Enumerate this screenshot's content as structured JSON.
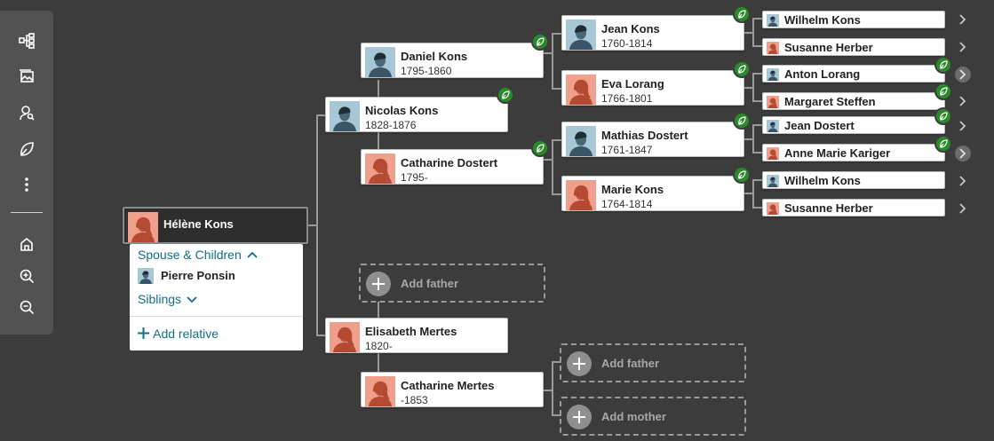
{
  "toolbar": {
    "items": [
      {
        "name": "tree-view-icon"
      },
      {
        "name": "media-icon"
      },
      {
        "name": "person-search-icon"
      },
      {
        "name": "hints-leaf-icon"
      },
      {
        "name": "more-options-icon"
      },
      {
        "name": "home-icon"
      },
      {
        "name": "zoom-in-icon"
      },
      {
        "name": "zoom-out-icon"
      }
    ]
  },
  "focus": {
    "name": "Hélène Kons",
    "gender": "female"
  },
  "panel": {
    "spouse_children_label": "Spouse & Children",
    "spouse_name": "Pierre Ponsin",
    "siblings_label": "Siblings",
    "add_relative_label": "Add relative"
  },
  "people": {
    "nicolas": {
      "name": "Nicolas Kons",
      "dates": "1828-1876",
      "gender": "male"
    },
    "elisabeth": {
      "name": "Elisabeth Mertes",
      "dates": "1820-",
      "gender": "female"
    },
    "daniel": {
      "name": "Daniel Kons",
      "dates": "1795-1860",
      "gender": "male"
    },
    "catharine_d": {
      "name": "Catharine Dostert",
      "dates": "1795-",
      "gender": "female"
    },
    "catharine_m": {
      "name": "Catharine Mertes",
      "dates": "-1853",
      "gender": "female"
    },
    "jean": {
      "name": "Jean Kons",
      "dates": "1760-1814",
      "gender": "male"
    },
    "eva": {
      "name": "Eva Lorang",
      "dates": "1766-1801",
      "gender": "female"
    },
    "mathias": {
      "name": "Mathias Dostert",
      "dates": "1761-1847",
      "gender": "male"
    },
    "marie": {
      "name": "Marie Kons",
      "dates": "1764-1814",
      "gender": "female"
    },
    "gen4": [
      {
        "name": "Wilhelm Kons",
        "gender": "male"
      },
      {
        "name": "Susanne Herber",
        "gender": "female"
      },
      {
        "name": "Anton Lorang",
        "gender": "male"
      },
      {
        "name": "Margaret Steffen",
        "gender": "female"
      },
      {
        "name": "Jean Dostert",
        "gender": "male"
      },
      {
        "name": "Anne Marie Kariger",
        "gender": "female"
      },
      {
        "name": "Wilhelm Kons",
        "gender": "male"
      },
      {
        "name": "Susanne Herber",
        "gender": "female"
      }
    ]
  },
  "add": {
    "father": "Add father",
    "mother": "Add mother"
  },
  "colors": {
    "background": "#3c3c3c",
    "male_avatar_bg": "#a7c6d6",
    "male_avatar_fg": "#3b5566",
    "female_avatar_bg": "#ef9f8c",
    "female_avatar_fg": "#b54a33",
    "hint_green": "#2b8a2b",
    "link_teal": "#0f6f84"
  }
}
